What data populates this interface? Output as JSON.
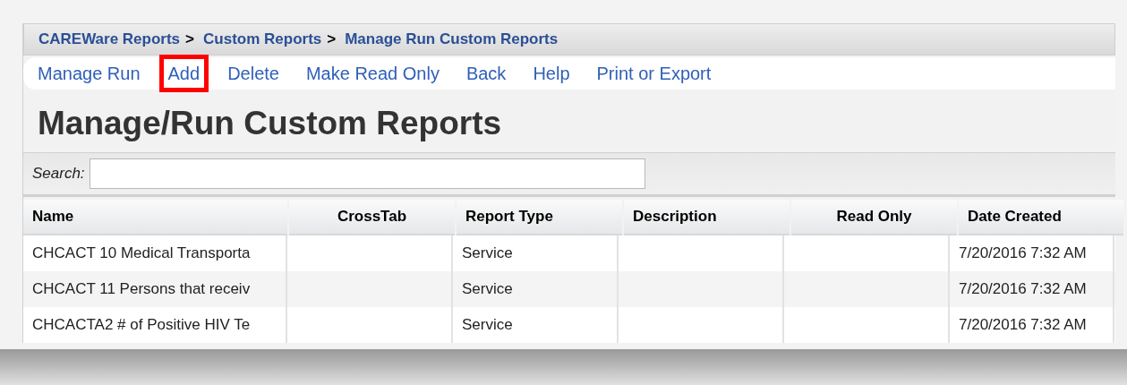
{
  "breadcrumb": [
    {
      "label": "CAREWare Reports",
      "separator": ">"
    },
    {
      "label": "Custom Reports",
      "separator": ">"
    },
    {
      "label": "Manage Run Custom Reports"
    }
  ],
  "menu": [
    {
      "label": "Manage Run",
      "highlighted": false
    },
    {
      "label": "Add",
      "highlighted": true
    },
    {
      "label": "Delete",
      "highlighted": false
    },
    {
      "label": "Make Read Only",
      "highlighted": false
    },
    {
      "label": "Back",
      "highlighted": false
    },
    {
      "label": "Help",
      "highlighted": false
    },
    {
      "label": "Print or Export",
      "highlighted": false
    }
  ],
  "title": "Manage/Run Custom Reports",
  "search": {
    "label": "Search:"
  },
  "table": {
    "columns": [
      {
        "label": "Name"
      },
      {
        "label": "CrossTab"
      },
      {
        "label": "Report Type"
      },
      {
        "label": "Description"
      },
      {
        "label": "Read Only"
      },
      {
        "label": "Date Created"
      }
    ],
    "rows": [
      [
        "CHCACT 10 Medical Transporta",
        "",
        "Service",
        "",
        "",
        "7/20/2016 7:32 AM"
      ],
      [
        "CHCACT 11 Persons that receiv",
        "",
        "Service",
        "",
        "",
        "7/20/2016 7:32 AM"
      ],
      [
        "CHCACTA2 # of Positive HIV Te",
        "",
        "Service",
        "",
        "",
        "7/20/2016 7:32 AM"
      ]
    ]
  }
}
